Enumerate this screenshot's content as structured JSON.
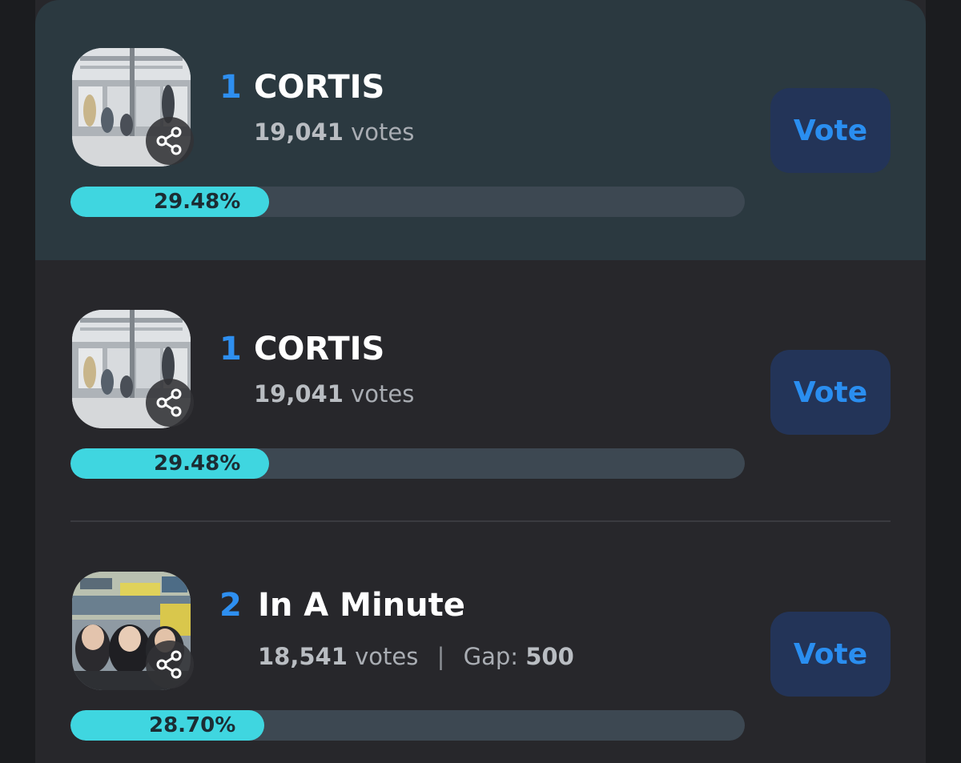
{
  "entries": [
    {
      "rank": "1",
      "name": "CORTIS",
      "votes_count": "19,041",
      "votes_suffix": "votes",
      "percent_label": "29.48%",
      "percent": 29.48,
      "vote_label": "Vote",
      "highlighted": true
    },
    {
      "rank": "1",
      "name": "CORTIS",
      "votes_count": "19,041",
      "votes_suffix": "votes",
      "percent_label": "29.48%",
      "percent": 29.48,
      "vote_label": "Vote",
      "highlighted": false
    },
    {
      "rank": "2",
      "name": "In A Minute",
      "votes_count": "18,541",
      "votes_suffix": "votes",
      "gap_label": "Gap:",
      "gap_value": "500",
      "percent_label": "28.70%",
      "percent": 28.7,
      "vote_label": "Vote",
      "highlighted": false
    }
  ],
  "icons": {
    "share": "share-icon"
  },
  "colors": {
    "rank": "#2e8ff0",
    "vote_button_bg": "#233458",
    "vote_button_text": "#2a8ef0",
    "bar_fill": "#3fd6e0",
    "bar_track": "#3d4852",
    "highlight_row": "#2b3940",
    "card": "#27272b"
  }
}
